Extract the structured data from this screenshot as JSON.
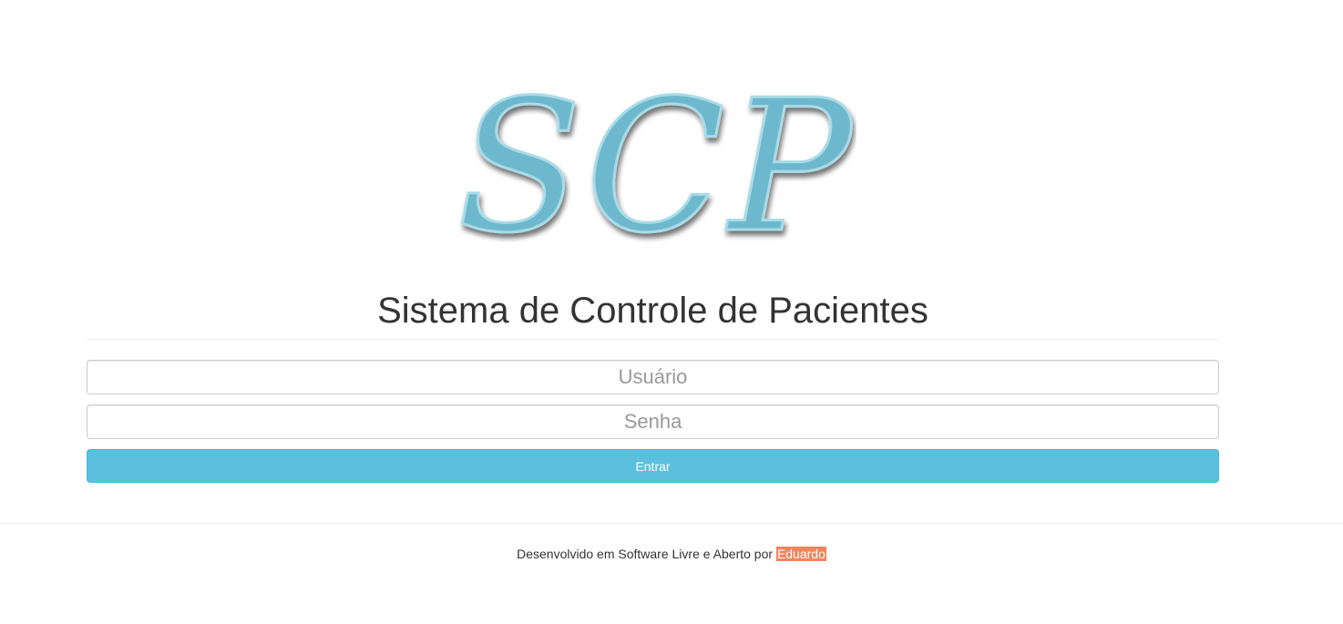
{
  "logo": {
    "text": "SCP",
    "fill_color": "#6db8cc",
    "outline_color": "#a9dbe8"
  },
  "page": {
    "title": "Sistema de Controle de Pacientes"
  },
  "login_form": {
    "username_placeholder": "Usuário",
    "username_value": "",
    "password_placeholder": "Senha",
    "password_value": "",
    "submit_label": "Entrar",
    "submit_color": "#5bc0de"
  },
  "footer": {
    "text": "Desenvolvido em Software Livre e Aberto por",
    "author_link": "Eduardo",
    "author_link_color": "#f0855e"
  }
}
